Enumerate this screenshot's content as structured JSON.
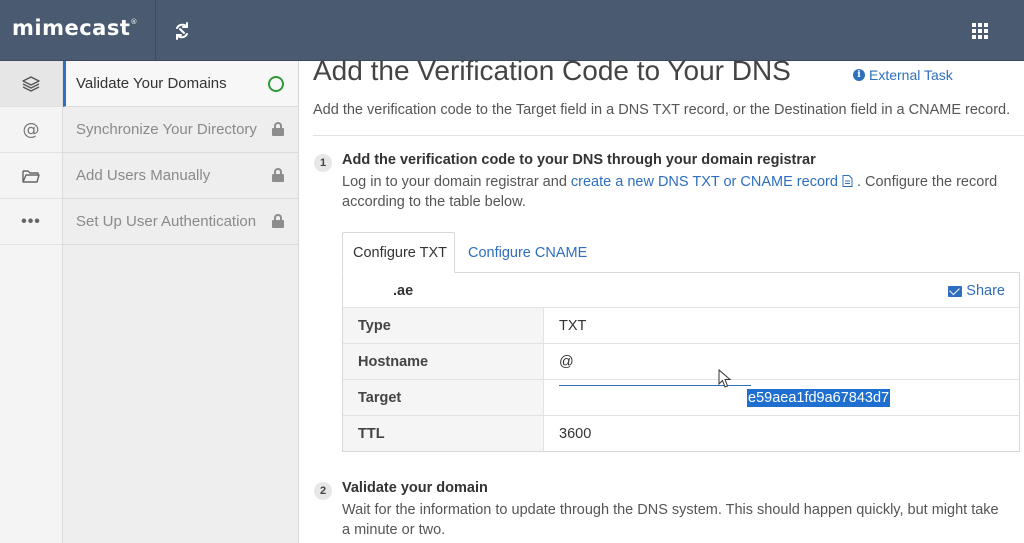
{
  "app": {
    "logo": "mimecast",
    "logo_mark": "®"
  },
  "rail": {
    "items": [
      "layers-icon",
      "at-icon",
      "folder-icon",
      "more-icon"
    ],
    "at_symbol": "@",
    "dots": "•••"
  },
  "steps": [
    {
      "label": "Validate Your Domains",
      "status": "in-progress"
    },
    {
      "label": "Synchronize Your Directory",
      "status": "locked"
    },
    {
      "label": "Add Users Manually",
      "status": "locked"
    },
    {
      "label": "Set Up User Authentication",
      "status": "locked"
    }
  ],
  "main": {
    "title": "Add the Verification Code to Your DNS",
    "external_task": "External Task",
    "info_glyph": "i",
    "subtitle": "Add the verification code to the Target field in a DNS TXT record, or the Destination field in a CNAME record.",
    "section1": {
      "number": "1",
      "title": "Add the verification code to your DNS through your domain registrar",
      "text_before": "Log in to your domain registrar and ",
      "link": "create a new DNS TXT or CNAME record",
      "text_after": " . Configure the record",
      "text_line2": "according to the table below."
    },
    "tabs": {
      "active": "Configure TXT",
      "inactive": "Configure CNAME"
    },
    "card": {
      "domain": ".ae",
      "share": "Share",
      "rows": [
        {
          "key": "Type",
          "value": "TXT"
        },
        {
          "key": "Hostname",
          "value": "@"
        },
        {
          "key": "Target",
          "value": "e59aea1fd9a67843d7"
        },
        {
          "key": "TTL",
          "value": "3600"
        }
      ]
    },
    "section2": {
      "number": "2",
      "title": "Validate your domain",
      "text_line1": "Wait for the information to update through the DNS system. This should happen quickly, but might take",
      "text_line2": "a minute or two."
    }
  },
  "colors": {
    "topbar": "#4a5a70",
    "accent": "#2e6fbf",
    "success": "#2e9a3a",
    "highlight": "#1e6fcf"
  }
}
